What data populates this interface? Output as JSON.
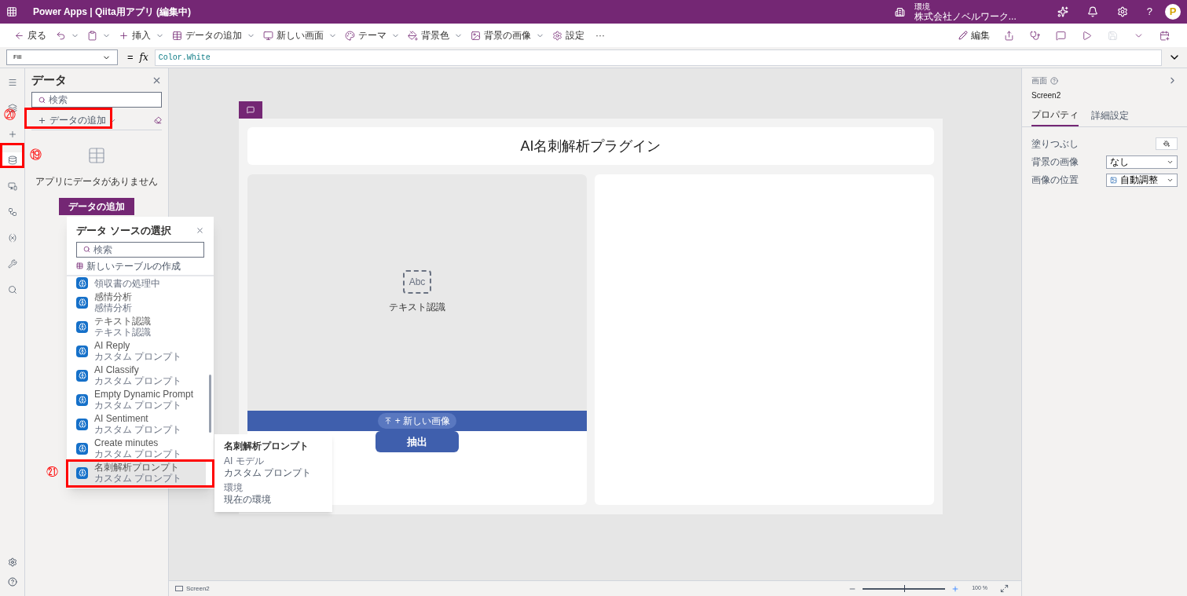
{
  "header": {
    "product": "Power Apps",
    "separator": "|",
    "app_title": "Qiita用アプリ (編集中)",
    "environment_label": "環境",
    "environment_name": "株式会社ノベルワーク...",
    "help": "?",
    "avatar_letter": "P"
  },
  "toolbar": {
    "left": [
      {
        "kind": "back",
        "label": "戻る"
      },
      {
        "kind": "undo"
      },
      {
        "kind": "paste"
      },
      {
        "kind": "insert",
        "label": "挿入"
      },
      {
        "kind": "data",
        "label": "データの追加"
      },
      {
        "kind": "screen",
        "label": "新しい画面"
      },
      {
        "kind": "theme",
        "label": "テーマ"
      },
      {
        "kind": "bgcolor",
        "label": "背景色"
      },
      {
        "kind": "bgimage",
        "label": "背景の画像"
      },
      {
        "kind": "settings",
        "label": "設定"
      },
      {
        "kind": "more",
        "label": "···"
      }
    ],
    "edit_label": "編集"
  },
  "formula_bar": {
    "property": "Fill",
    "equals": "=",
    "fx": "fx",
    "formula": "Color.White"
  },
  "data_panel": {
    "title": "データ",
    "search_placeholder": "検索",
    "add_data": "データの追加",
    "empty_text": "アプリにデータがありません",
    "add_button": "データの追加"
  },
  "rail": [
    {
      "kind": "menu",
      "selected": false
    },
    {
      "kind": "layers",
      "selected": false
    },
    {
      "kind": "plus",
      "selected": false
    },
    {
      "kind": "data",
      "selected": true
    },
    {
      "kind": "media",
      "selected": false
    },
    {
      "kind": "flow",
      "selected": false
    },
    {
      "kind": "vars",
      "selected": false
    },
    {
      "kind": "tools",
      "selected": false
    },
    {
      "kind": "search",
      "selected": false
    }
  ],
  "data_source_popup": {
    "title": "データ ソースの選択",
    "search_placeholder": "検索",
    "new_table": "新しいテーブルの作成",
    "items": [
      {
        "sub": "領収書の処理中",
        "selected": false
      },
      {
        "name": "感情分析",
        "sub": "感情分析",
        "selected": false
      },
      {
        "name": "テキスト認識",
        "sub": "テキスト認識",
        "selected": false
      },
      {
        "name": "AI Reply",
        "sub": "カスタム プロンプト",
        "selected": false
      },
      {
        "name": "AI Classify",
        "sub": "カスタム プロンプト",
        "selected": false
      },
      {
        "name": "Empty Dynamic Prompt",
        "sub": "カスタム プロンプト",
        "selected": false
      },
      {
        "name": "AI Sentiment",
        "sub": "カスタム プロンプト",
        "selected": false
      },
      {
        "name": "Create minutes",
        "sub": "カスタム プロンプト",
        "selected": false
      },
      {
        "name": "名刺解析プロンプト",
        "sub": "カスタム プロンプト",
        "selected": true
      }
    ]
  },
  "tooltip": {
    "title": "名刺解析プロンプト",
    "model_label": "AI モデル",
    "model_value": "カスタム プロンプト",
    "env_label": "環境",
    "env_value": "現在の環境"
  },
  "app_screen": {
    "title": "AI名刺解析プラグイン",
    "text_recognition": "テキスト認識",
    "abc": "Abc",
    "new_image": "+ 新しい画像",
    "extract_button": "抽出"
  },
  "annotations": [
    {
      "label": "⑳"
    },
    {
      "label": "⑲"
    },
    {
      "label": "㉑"
    }
  ],
  "properties_panel": {
    "type_label": "画面",
    "screen_name": "Screen2",
    "tabs": [
      {
        "label": "プロパティ",
        "selected": true
      },
      {
        "label": "詳細設定",
        "selected": false
      }
    ],
    "rows": [
      {
        "kind": "color",
        "label": "塗りつぶし"
      },
      {
        "kind": "select",
        "label": "背景の画像",
        "value": "なし"
      },
      {
        "kind": "select-icon",
        "label": "画像の位置",
        "value": "自動調整"
      }
    ]
  },
  "status_bar": {
    "screen": "Screen2",
    "zoom": {
      "level": 0.5
    },
    "zoom_text": "100 %"
  }
}
